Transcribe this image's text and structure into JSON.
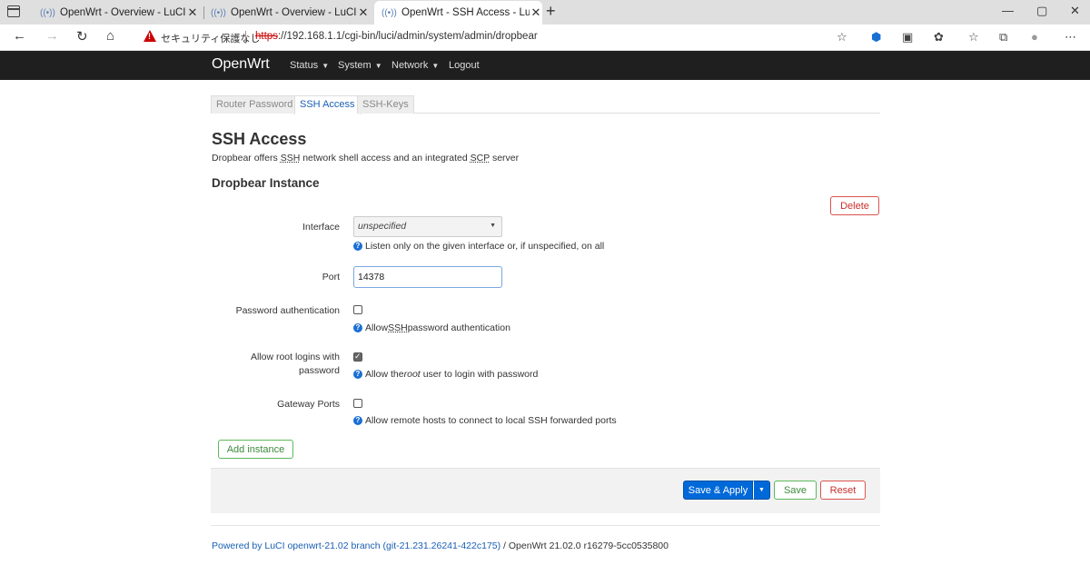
{
  "browser": {
    "tabs": [
      {
        "title": "OpenWrt - Overview - LuCI",
        "favicon": "((•))",
        "close": "✕"
      },
      {
        "title": "OpenWrt - Overview - LuCI",
        "favicon": "((•))",
        "close": "✕"
      },
      {
        "title": "OpenWrt - SSH Access - LuCI",
        "favicon": "((•))",
        "close": "✕"
      }
    ],
    "new_tab": "+",
    "window_controls": {
      "minimize": "—",
      "maximize": "▢",
      "close": "✕"
    },
    "security_label": "セキュリティ保護なし",
    "url_protocol": "https",
    "url_rest": "://192.168.1.1/cgi-bin/luci/admin/system/admin/dropbear",
    "nav": {
      "back": "←",
      "forward": "→",
      "reload": "↻",
      "home": "⌂"
    },
    "toolbar_icons": [
      "☆",
      "⬢",
      "▣",
      "✿",
      "☆",
      "⧉",
      "●",
      "⋯"
    ]
  },
  "luci": {
    "brand": "OpenWrt",
    "menu": [
      {
        "label": "Status",
        "caret": "▼"
      },
      {
        "label": "System",
        "caret": "▼"
      },
      {
        "label": "Network",
        "caret": "▼"
      },
      {
        "label": "Logout",
        "caret": ""
      }
    ]
  },
  "tabs": [
    {
      "label": "Router Password",
      "active": false
    },
    {
      "label": "SSH Access",
      "active": true
    },
    {
      "label": "SSH-Keys",
      "active": false
    }
  ],
  "page": {
    "title": "SSH Access",
    "desc_prefix": "Dropbear offers ",
    "desc_ssh": "SSH",
    "desc_mid": " network shell access and an integrated ",
    "desc_scp": "SCP",
    "desc_suffix": " server"
  },
  "section": {
    "title": "Dropbear Instance",
    "delete_label": "Delete"
  },
  "fields": {
    "interface": {
      "label": "Interface",
      "value": "unspecified",
      "caret": "▼",
      "help": "Listen only on the given interface or, if unspecified, on all"
    },
    "port": {
      "label": "Port",
      "value": "14378"
    },
    "password_auth": {
      "label": "Password authentication",
      "checked": false,
      "help_prefix": "Allow ",
      "help_abbr": "SSH",
      "help_suffix": " password authentication"
    },
    "root_login": {
      "label_line1": "Allow root logins with",
      "label_line2": "password",
      "checked": true,
      "help_prefix": "Allow the ",
      "help_em": "root",
      "help_suffix": " user to login with password"
    },
    "gateway_ports": {
      "label": "Gateway Ports",
      "checked": false,
      "help": "Allow remote hosts to connect to local SSH forwarded ports"
    }
  },
  "add_instance_label": "Add instance",
  "actions": {
    "save_apply": "Save & Apply",
    "caret": "▼",
    "save": "Save",
    "reset": "Reset"
  },
  "footer": {
    "link_text": "Powered by LuCI openwrt-21.02 branch (git-21.231.26241-422c175)",
    "rest": " / OpenWrt 21.02.0 r16279-5cc0535800"
  },
  "help_glyph": "?",
  "colors": {
    "header_bg": "#1f1f1f",
    "primary": "#0069d9",
    "negative": "#d9534f",
    "positive": "#5cb85c",
    "link": "#1a5fb4"
  }
}
